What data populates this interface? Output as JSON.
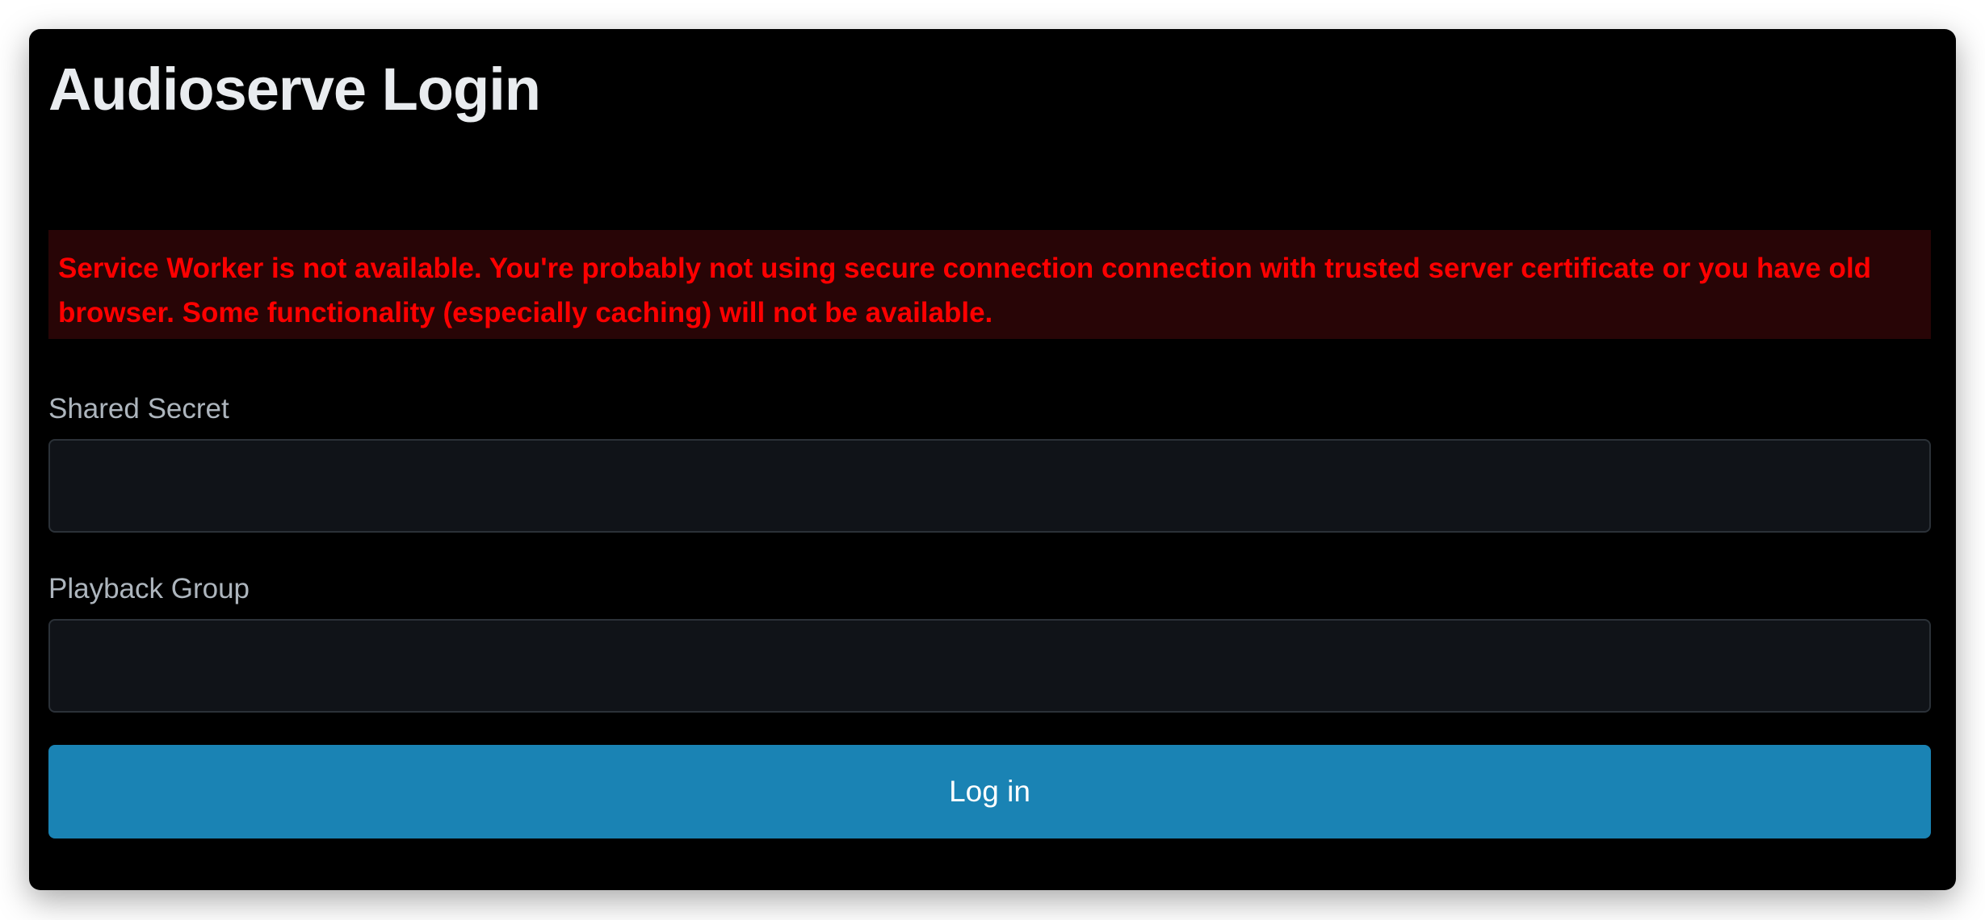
{
  "page": {
    "title": "Audioserve Login",
    "alert": "Service Worker is not available. You're probably not using secure connection connection with trusted server certificate or you have old browser. Some functionality (especially caching) will not be available.",
    "colors": {
      "alert_text": "#ff0000",
      "alert_bg": "#280506",
      "button": "#1a83b4"
    }
  },
  "form": {
    "secret_label": "Shared Secret",
    "secret_value": "",
    "group_label": "Playback Group",
    "group_value": "",
    "submit_label": "Log in"
  }
}
